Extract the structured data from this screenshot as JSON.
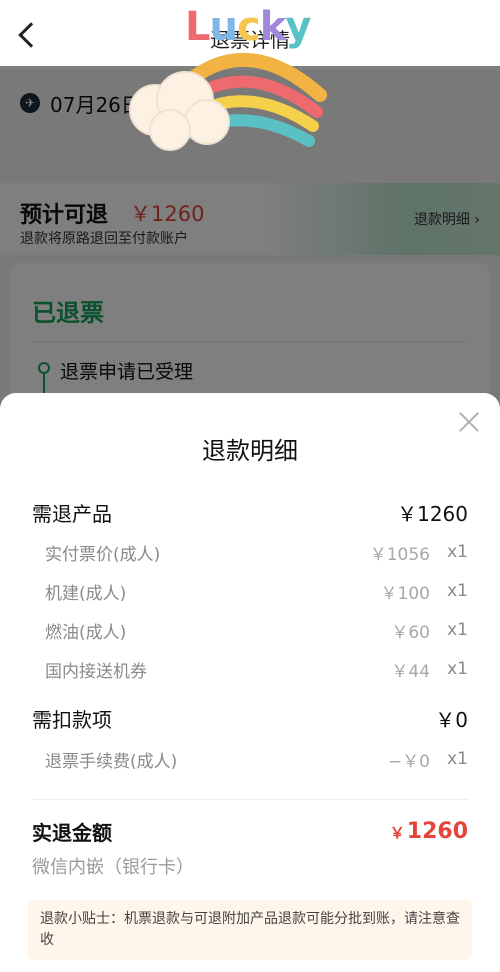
{
  "nav": {
    "title": "退票详情"
  },
  "flight": {
    "date": "07月26日"
  },
  "estimate": {
    "label": "预计可退",
    "amount": "￥1260",
    "note": "退款将原路退回至付款账户",
    "detail_link": "退款明细 ›"
  },
  "status": {
    "title": "已退票",
    "step": "退票申请已受理"
  },
  "sticker": {
    "text": "Lucky"
  },
  "sheet": {
    "title": "退款明细",
    "refund_products": {
      "label": "需退产品",
      "value": "￥1260",
      "items": [
        {
          "name": "实付票价(成人)",
          "price": "￥1056",
          "qty": "x1"
        },
        {
          "name": "机建(成人)",
          "price": "￥100",
          "qty": "x1"
        },
        {
          "name": "燃油(成人)",
          "price": "￥60",
          "qty": "x1"
        },
        {
          "name": "国内接送机券",
          "price": "￥44",
          "qty": "x1"
        }
      ]
    },
    "deductions": {
      "label": "需扣款项",
      "value": "￥0",
      "items": [
        {
          "name": "退票手续费(成人)",
          "price": "−￥0",
          "qty": "x1"
        }
      ]
    },
    "total": {
      "label": "实退金额",
      "currency": "￥",
      "amount": "1260"
    },
    "pay_method": "微信内嵌（银行卡）",
    "tip": "退款小贴士：机票退款与可退附加产品退款可能分批到账，请注意查收"
  },
  "colors": {
    "accent_red": "#e4453a",
    "status_green": "#19a25d",
    "tip_bg": "#fff5ea"
  }
}
